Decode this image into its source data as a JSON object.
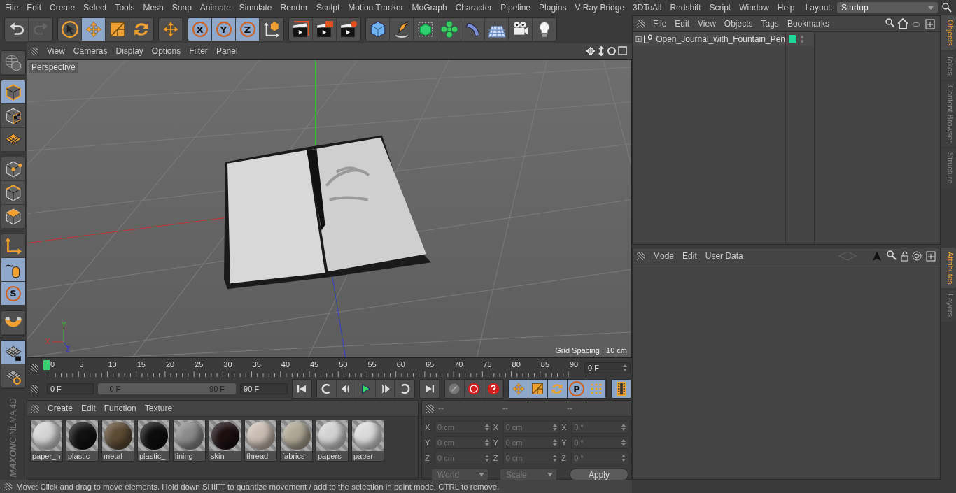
{
  "menubar": {
    "items": [
      "File",
      "Edit",
      "Create",
      "Select",
      "Tools",
      "Mesh",
      "Snap",
      "Animate",
      "Simulate",
      "Render",
      "Sculpt",
      "Motion Tracker",
      "MoGraph",
      "Character",
      "Pipeline",
      "Plugins",
      "V-Ray Bridge",
      "3DToAll",
      "Redshift",
      "Script",
      "Window",
      "Help"
    ],
    "layout_label": "Layout:",
    "layout_value": "Startup"
  },
  "toolbar": [
    {
      "tools": [
        {
          "kind": "undo",
          "selected": false
        },
        {
          "kind": "redo",
          "selected": false
        }
      ]
    },
    {
      "tools": [
        {
          "kind": "live-select",
          "selected": false
        },
        {
          "kind": "move",
          "selected": true
        },
        {
          "kind": "scale",
          "selected": false
        },
        {
          "kind": "rotate",
          "selected": false
        }
      ]
    },
    {
      "tools": [
        {
          "kind": "recent-tool",
          "selected": false
        }
      ]
    },
    {
      "tools": [
        {
          "kind": "axis-lock",
          "label": "X",
          "selected": true
        },
        {
          "kind": "axis-lock",
          "label": "Y",
          "selected": true
        },
        {
          "kind": "axis-lock",
          "label": "Z",
          "selected": true
        },
        {
          "kind": "coord-system",
          "selected": false
        }
      ]
    },
    {
      "tools": [
        {
          "kind": "render-view",
          "selected": false
        },
        {
          "kind": "render-picture",
          "selected": false
        },
        {
          "kind": "render-settings",
          "selected": false
        }
      ]
    },
    {
      "tools": [
        {
          "kind": "cube",
          "selected": false
        },
        {
          "kind": "pen",
          "selected": false
        },
        {
          "kind": "subdivision",
          "selected": false
        },
        {
          "kind": "cloner",
          "selected": false
        },
        {
          "kind": "deformer",
          "selected": false
        },
        {
          "kind": "floor",
          "selected": false
        },
        {
          "kind": "camera",
          "selected": false
        },
        {
          "kind": "light",
          "selected": false
        }
      ]
    }
  ],
  "left_toolbar": [
    {
      "tools": [
        {
          "kind": "globe",
          "selected": false
        }
      ]
    },
    {
      "tools": [
        {
          "kind": "model",
          "selected": true
        },
        {
          "kind": "texture",
          "selected": false
        },
        {
          "kind": "workplane",
          "selected": false
        }
      ]
    },
    {
      "tools": [
        {
          "kind": "points",
          "selected": false
        },
        {
          "kind": "edges",
          "selected": false
        },
        {
          "kind": "polygons",
          "selected": false
        }
      ]
    },
    {
      "tools": [
        {
          "kind": "axis",
          "selected": false
        },
        {
          "kind": "tweak",
          "selected": true
        },
        {
          "kind": "snap",
          "label": "S",
          "selected": true
        }
      ]
    },
    {
      "tools": [
        {
          "kind": "magnet",
          "selected": false
        }
      ]
    },
    {
      "tools": [
        {
          "kind": "grid-lock",
          "selected": true
        },
        {
          "kind": "grid-cycle",
          "selected": false
        }
      ]
    }
  ],
  "logo": {
    "brand": "MAXON",
    "product": "CINEMA 4D"
  },
  "viewport": {
    "menu": [
      "View",
      "Cameras",
      "Display",
      "Options",
      "Filter",
      "Panel"
    ],
    "camera": "Perspective",
    "grid_spacing": "Grid Spacing : 10 cm",
    "gizmo_labels": [
      "X",
      "Y",
      "Z"
    ]
  },
  "timeline": {
    "ticks": [
      "0",
      "5",
      "10",
      "15",
      "20",
      "25",
      "30",
      "35",
      "40",
      "45",
      "50",
      "55",
      "60",
      "65",
      "70",
      "75",
      "80",
      "85",
      "90"
    ],
    "playhead": {
      "level": 0
    },
    "current": "0 F",
    "start": "0 F",
    "range": {
      "start": "0 F",
      "end": "90 F",
      "level": 1
    },
    "end": "90 F",
    "transport": [
      {
        "kind": "first"
      },
      {
        "kind": "prev-key"
      },
      {
        "kind": "prev-frame"
      },
      {
        "kind": "play"
      },
      {
        "kind": "next-frame"
      },
      {
        "kind": "next-key"
      },
      {
        "kind": "last"
      }
    ],
    "record": [
      {
        "kind": "record-off"
      },
      {
        "kind": "autokey"
      },
      {
        "kind": "key-help"
      }
    ],
    "keys": [
      {
        "kind": "key-move",
        "selected": true
      },
      {
        "kind": "key-scale",
        "selected": true
      },
      {
        "kind": "key-rotate",
        "selected": true
      },
      {
        "kind": "key-param",
        "label": "P",
        "selected": true
      },
      {
        "kind": "key-grid",
        "selected": true
      }
    ],
    "film": {
      "selected": true
    }
  },
  "materials": {
    "menu": [
      "Create",
      "Edit",
      "Function",
      "Texture"
    ],
    "items": [
      {
        "name": "paper_h",
        "color": "#d4d4d4"
      },
      {
        "name": "plastic",
        "color": "#111111"
      },
      {
        "name": "metal",
        "color": "#5c4b34"
      },
      {
        "name": "plastic_",
        "color": "#0d0d0d"
      },
      {
        "name": "lining",
        "color": "#8a8a8a"
      },
      {
        "name": "skin",
        "color": "#1c0f12"
      },
      {
        "name": "thread",
        "color": "#c9bdb2"
      },
      {
        "name": "fabrics",
        "color": "#aea694"
      },
      {
        "name": "papers",
        "color": "#d2d2d2"
      },
      {
        "name": "paper",
        "color": "#dadada"
      }
    ]
  },
  "coordinates": {
    "headers": [
      "--",
      "--",
      "--"
    ],
    "rows": [
      {
        "cells": [
          {
            "label": "X",
            "value": "0 cm"
          },
          {
            "label": "X",
            "value": "0 cm"
          },
          {
            "label": "X",
            "value": "0 °"
          }
        ]
      },
      {
        "cells": [
          {
            "label": "Y",
            "value": "0 cm"
          },
          {
            "label": "Y",
            "value": "0 cm"
          },
          {
            "label": "Y",
            "value": "0 °"
          }
        ]
      },
      {
        "cells": [
          {
            "label": "Z",
            "value": "0 cm"
          },
          {
            "label": "Z",
            "value": "0 cm"
          },
          {
            "label": "Z",
            "value": "0 °"
          }
        ]
      }
    ],
    "space": "World",
    "mode": "Scale",
    "apply": "Apply"
  },
  "status_bar": "Move: Click and drag to move elements. Hold down SHIFT to quantize movement / add to the selection in point mode, CTRL to remove.",
  "objects_panel": {
    "menu": [
      "File",
      "Edit",
      "View",
      "Objects",
      "Tags",
      "Bookmarks"
    ],
    "objects": [
      {
        "name": "Open_Journal_with_Fountain_Pen",
        "expanded": false,
        "color": "#1fd898"
      }
    ],
    "side_tabs": [
      {
        "label": "Objects",
        "selected": true
      },
      {
        "label": "Takes",
        "selected": false
      },
      {
        "label": "Content Browser",
        "selected": false
      },
      {
        "label": "Structure",
        "selected": false
      }
    ]
  },
  "attributes_panel": {
    "menu": [
      "Mode",
      "Edit",
      "User Data"
    ],
    "side_tabs": [
      {
        "label": "Attributes",
        "selected": true
      },
      {
        "label": "Layers",
        "selected": false
      }
    ]
  }
}
